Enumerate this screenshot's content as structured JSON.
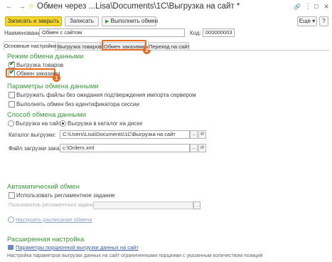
{
  "window": {
    "title": "Обмен через ...Lisa\\Documents\\1С\\Выгрузка на сайт *",
    "back_glyph": "←",
    "forward_glyph": "→",
    "star_glyph": "☆",
    "link_glyph": "🔗",
    "menu_glyph": "⋮",
    "maximize_glyph": "□",
    "close_glyph": "×"
  },
  "toolbar": {
    "save_close_label": "Записать и закрыть",
    "save_label": "Записать",
    "run_exchange_label": "Выполнить обмен",
    "more_label": "Еще ▾",
    "help_label": "?"
  },
  "form": {
    "name_label": "Наименование:",
    "name_value": "Обмен с сайтом",
    "code_label": "Код:",
    "code_value": "000000003"
  },
  "tabs": [
    {
      "label": "Основные настройки"
    },
    {
      "label": "Выгрузка товаров"
    },
    {
      "label": "Обмен заказами"
    },
    {
      "label": "Переход на сайт"
    }
  ],
  "exchange_mode": {
    "heading": "Режим обмена данными",
    "export_goods_label": "Выгрузка товаров",
    "order_exchange_label": "Обмен заказами"
  },
  "exchange_params": {
    "heading": "Параметры обмена данными",
    "no_confirm_label": "Выгружать файлы без ожидания подтверждения импорта сервером",
    "no_session_label": "Выполнять обмен без идентификатора сессии"
  },
  "exchange_method": {
    "heading": "Способ обмена данными",
    "to_site_label": "Выгрузка на сайт",
    "to_disk_label": "Выгрузка в каталог на диске",
    "catalog_label": "Каталог выгрузки:",
    "catalog_value": "C:\\Users\\Lisa\\Documents\\1С\\Выгрузка на сайт",
    "orders_file_label": "Файл загрузки заказов:",
    "orders_file_value": "c:\\Orders.xml"
  },
  "auto_exchange": {
    "heading": "Автоматический обмен",
    "use_task_label": "Использовать регламентное задание",
    "task_user_label": "Пользователь регламентного задания:",
    "schedule_link": "Настроить расписание обмена"
  },
  "advanced": {
    "heading": "Расширенная настройка",
    "batch_link": "Параметры порционной выгрузки данных на сайт",
    "batch_desc": "Настройка параметров выгрузки данных на сайт ограниченными порциями с указанным количеством позиций"
  },
  "callouts": {
    "first": "1",
    "second": "2"
  },
  "colors": {
    "accent": "#e86a1e",
    "section": "#3a9a3a",
    "primary_button": "#f5d72a"
  }
}
